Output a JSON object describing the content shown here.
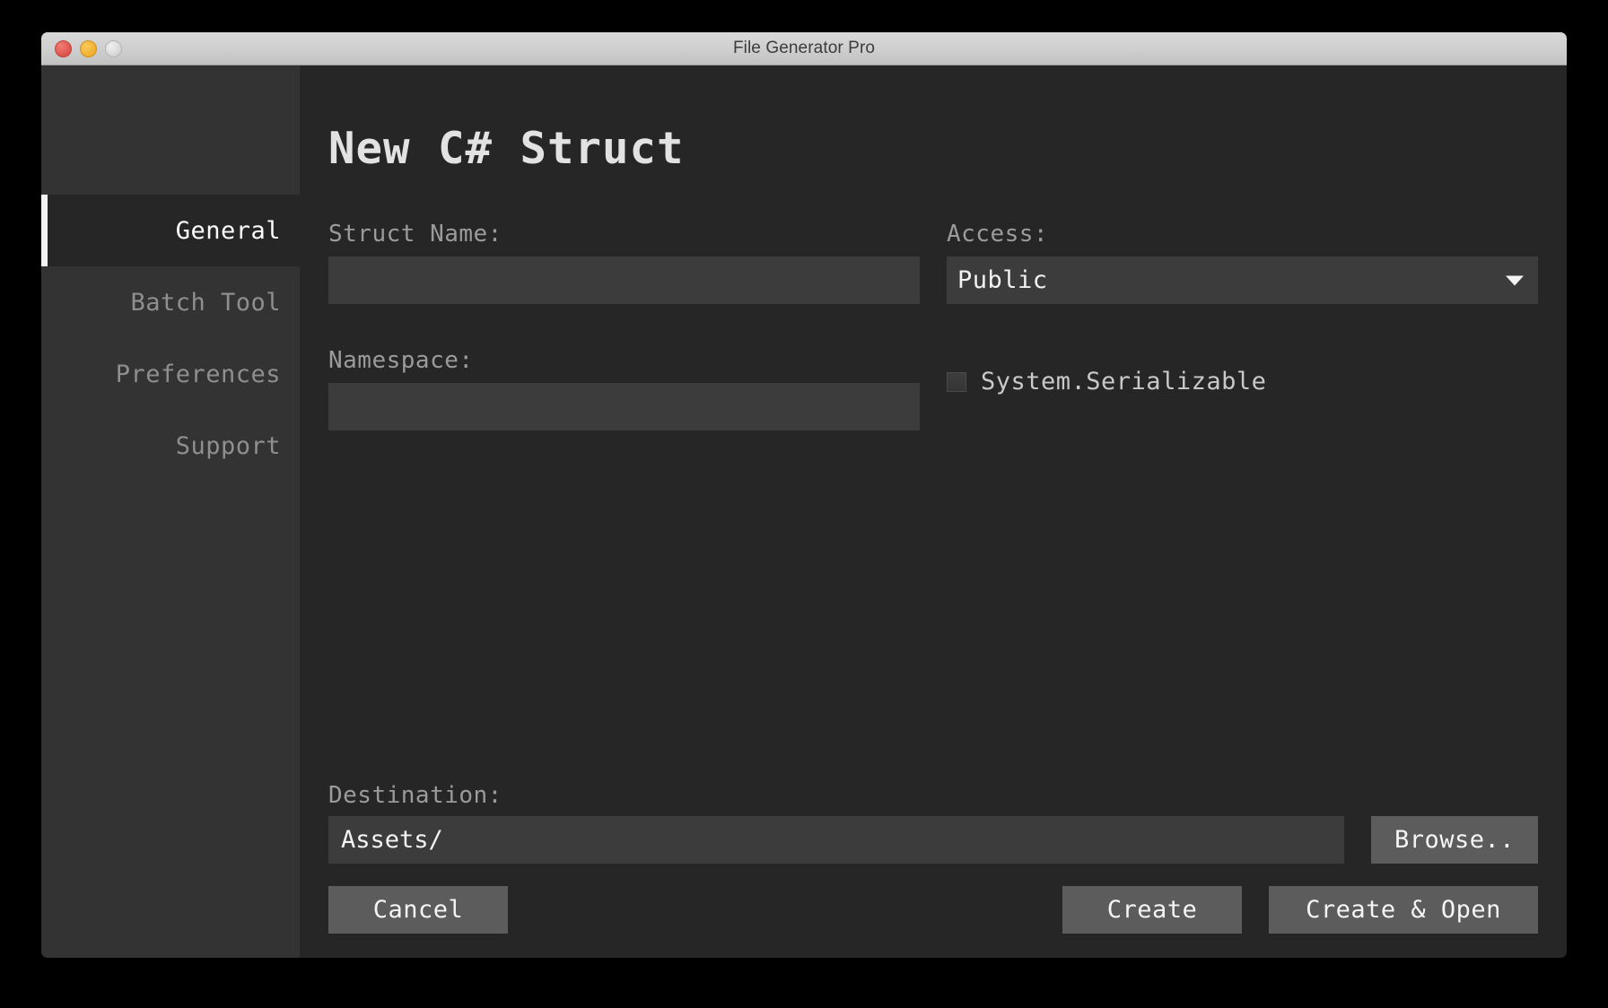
{
  "window": {
    "title": "File Generator Pro",
    "traffic_lights": [
      {
        "name": "close",
        "color": "#dd5148"
      },
      {
        "name": "minimize",
        "color": "#f0ad2a"
      },
      {
        "name": "zoom",
        "color": "#d2d2d2"
      }
    ]
  },
  "sidebar": {
    "items": [
      {
        "label": "General",
        "active": true
      },
      {
        "label": "Batch Tool",
        "active": false
      },
      {
        "label": "Preferences",
        "active": false
      },
      {
        "label": "Support",
        "active": false
      }
    ]
  },
  "main": {
    "title": "New C# Struct",
    "fields": {
      "struct_name": {
        "label": "Struct Name:",
        "value": "",
        "placeholder": ""
      },
      "namespace": {
        "label": "Namespace:",
        "value": "",
        "placeholder": ""
      },
      "access": {
        "label": "Access:",
        "value": "Public"
      },
      "serializable": {
        "label": "System.Serializable",
        "checked": false
      }
    },
    "destination": {
      "label": "Destination:",
      "value": "Assets/",
      "browse_label": "Browse.."
    },
    "actions": {
      "cancel": "Cancel",
      "create": "Create",
      "create_and_open": "Create & Open"
    }
  },
  "colors": {
    "window_chrome": "#cfcfcf",
    "sidebar_bg": "#333333",
    "content_bg": "#262626",
    "input_bg": "#3c3c3c",
    "button_bg": "#5c5c5c",
    "active_indicator": "#f2f2f2",
    "label_text": "#9b9b9b",
    "value_text": "#f2f2f2"
  }
}
